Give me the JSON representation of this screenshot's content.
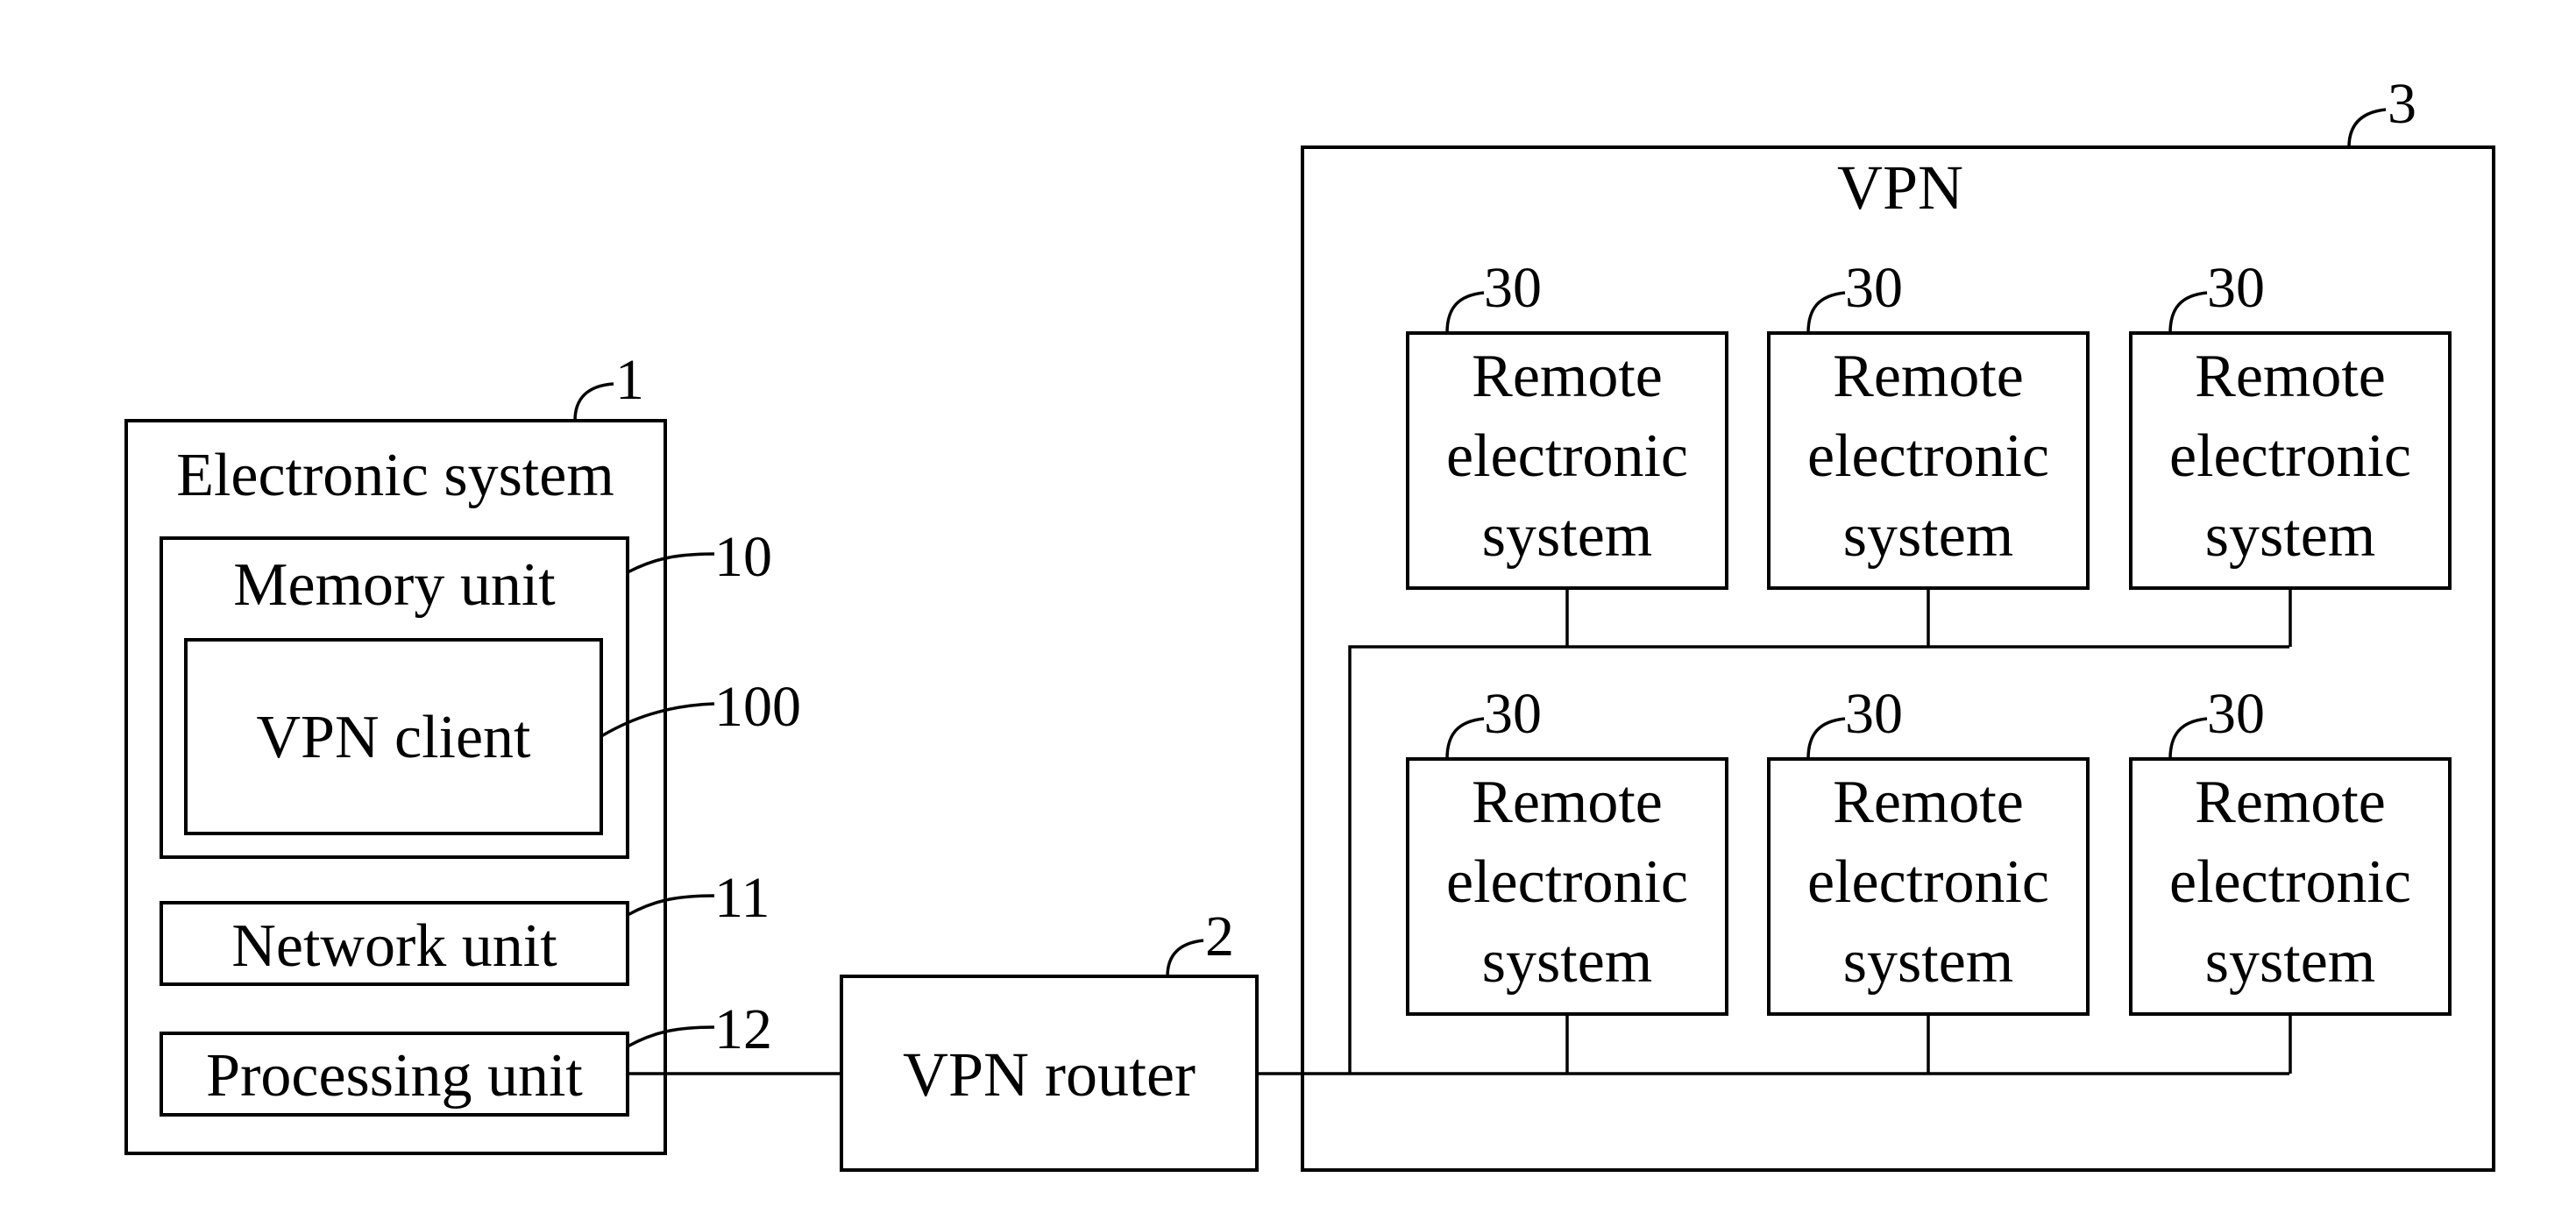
{
  "figure": {
    "electronic_system": {
      "title": "Electronic system",
      "ref": "1",
      "memory_unit": {
        "label": "Memory unit",
        "ref": "10"
      },
      "vpn_client": {
        "label": "VPN client",
        "ref": "100"
      },
      "network_unit": {
        "label": "Network unit",
        "ref": "11"
      },
      "processing_unit": {
        "label": "Processing unit",
        "ref": "12"
      }
    },
    "vpn_router": {
      "label": "VPN router",
      "ref": "2"
    },
    "vpn": {
      "title": "VPN",
      "ref": "3",
      "remote_systems": [
        {
          "lines": [
            "Remote",
            "electronic",
            "system"
          ],
          "ref": "30"
        },
        {
          "lines": [
            "Remote",
            "electronic",
            "system"
          ],
          "ref": "30"
        },
        {
          "lines": [
            "Remote",
            "electronic",
            "system"
          ],
          "ref": "30"
        },
        {
          "lines": [
            "Remote",
            "electronic",
            "system"
          ],
          "ref": "30"
        },
        {
          "lines": [
            "Remote",
            "electronic",
            "system"
          ],
          "ref": "30"
        },
        {
          "lines": [
            "Remote",
            "electronic",
            "system"
          ],
          "ref": "30"
        }
      ]
    }
  }
}
